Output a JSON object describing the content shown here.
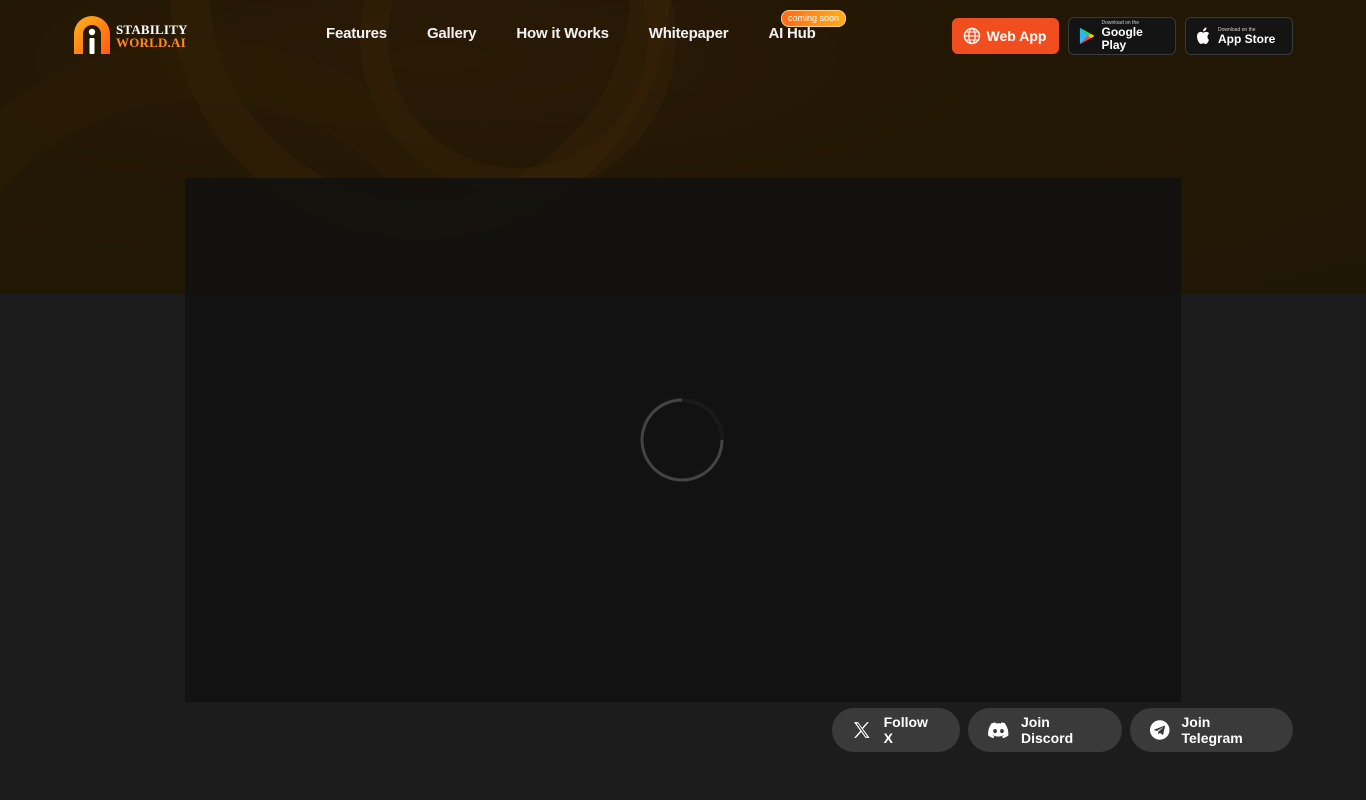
{
  "brand": {
    "line1": "STABILITY",
    "line2": "WORLD.AI"
  },
  "nav": {
    "items": [
      "Features",
      "Gallery",
      "How it Works",
      "Whitepaper",
      "AI Hub"
    ],
    "badge": "coming soon"
  },
  "actions": {
    "web_app": "Web App",
    "google_play_small": "Download on the",
    "google_play": "Google Play",
    "app_store_small": "Download on the",
    "app_store": "App Store"
  },
  "social": {
    "follow_x": "Follow X",
    "discord": "Join Discord",
    "telegram": "Join Telegram"
  },
  "colors": {
    "accent": "#f04e1e",
    "brand_orange": "#ff8a1f",
    "background": "#1c1c1c",
    "pill": "#3a3a3a"
  },
  "icons": [
    "logo-icon",
    "globe-icon",
    "google-play-icon",
    "apple-icon",
    "x-icon",
    "discord-icon",
    "telegram-icon",
    "loading-spinner"
  ]
}
